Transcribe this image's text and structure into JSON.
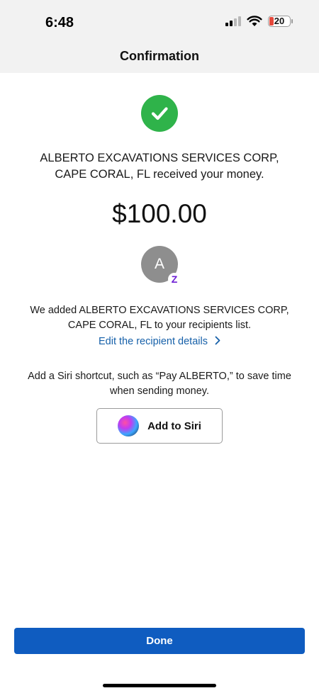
{
  "status_bar": {
    "time": "6:48",
    "battery_level": "20",
    "icons": [
      "cellular-signal-icon",
      "wifi-icon",
      "battery-icon"
    ]
  },
  "header": {
    "title": "Confirmation"
  },
  "confirmation": {
    "status_icon": "checkmark-circle-icon",
    "received_message": "ALBERTO EXCAVATIONS SERVICES CORP, CAPE CORAL, FL received your money.",
    "amount": "$100.00"
  },
  "recipient": {
    "avatar_initial": "A",
    "badge_glyph": "Z",
    "added_message": "We added ALBERTO EXCAVATIONS SERVICES CORP, CAPE CORAL, FL to your recipients list.",
    "edit_link_label": "Edit the recipient details"
  },
  "siri": {
    "message": "Add a Siri shortcut, such as “Pay ALBERTO,” to save time when sending money.",
    "button_label": "Add to Siri"
  },
  "footer": {
    "done_label": "Done"
  },
  "colors": {
    "success_green": "#2fb34a",
    "link_blue": "#1660a9",
    "primary_button": "#0f5cc0",
    "zelle_purple": "#6d1ed4",
    "battery_low_red": "#e5483b"
  }
}
